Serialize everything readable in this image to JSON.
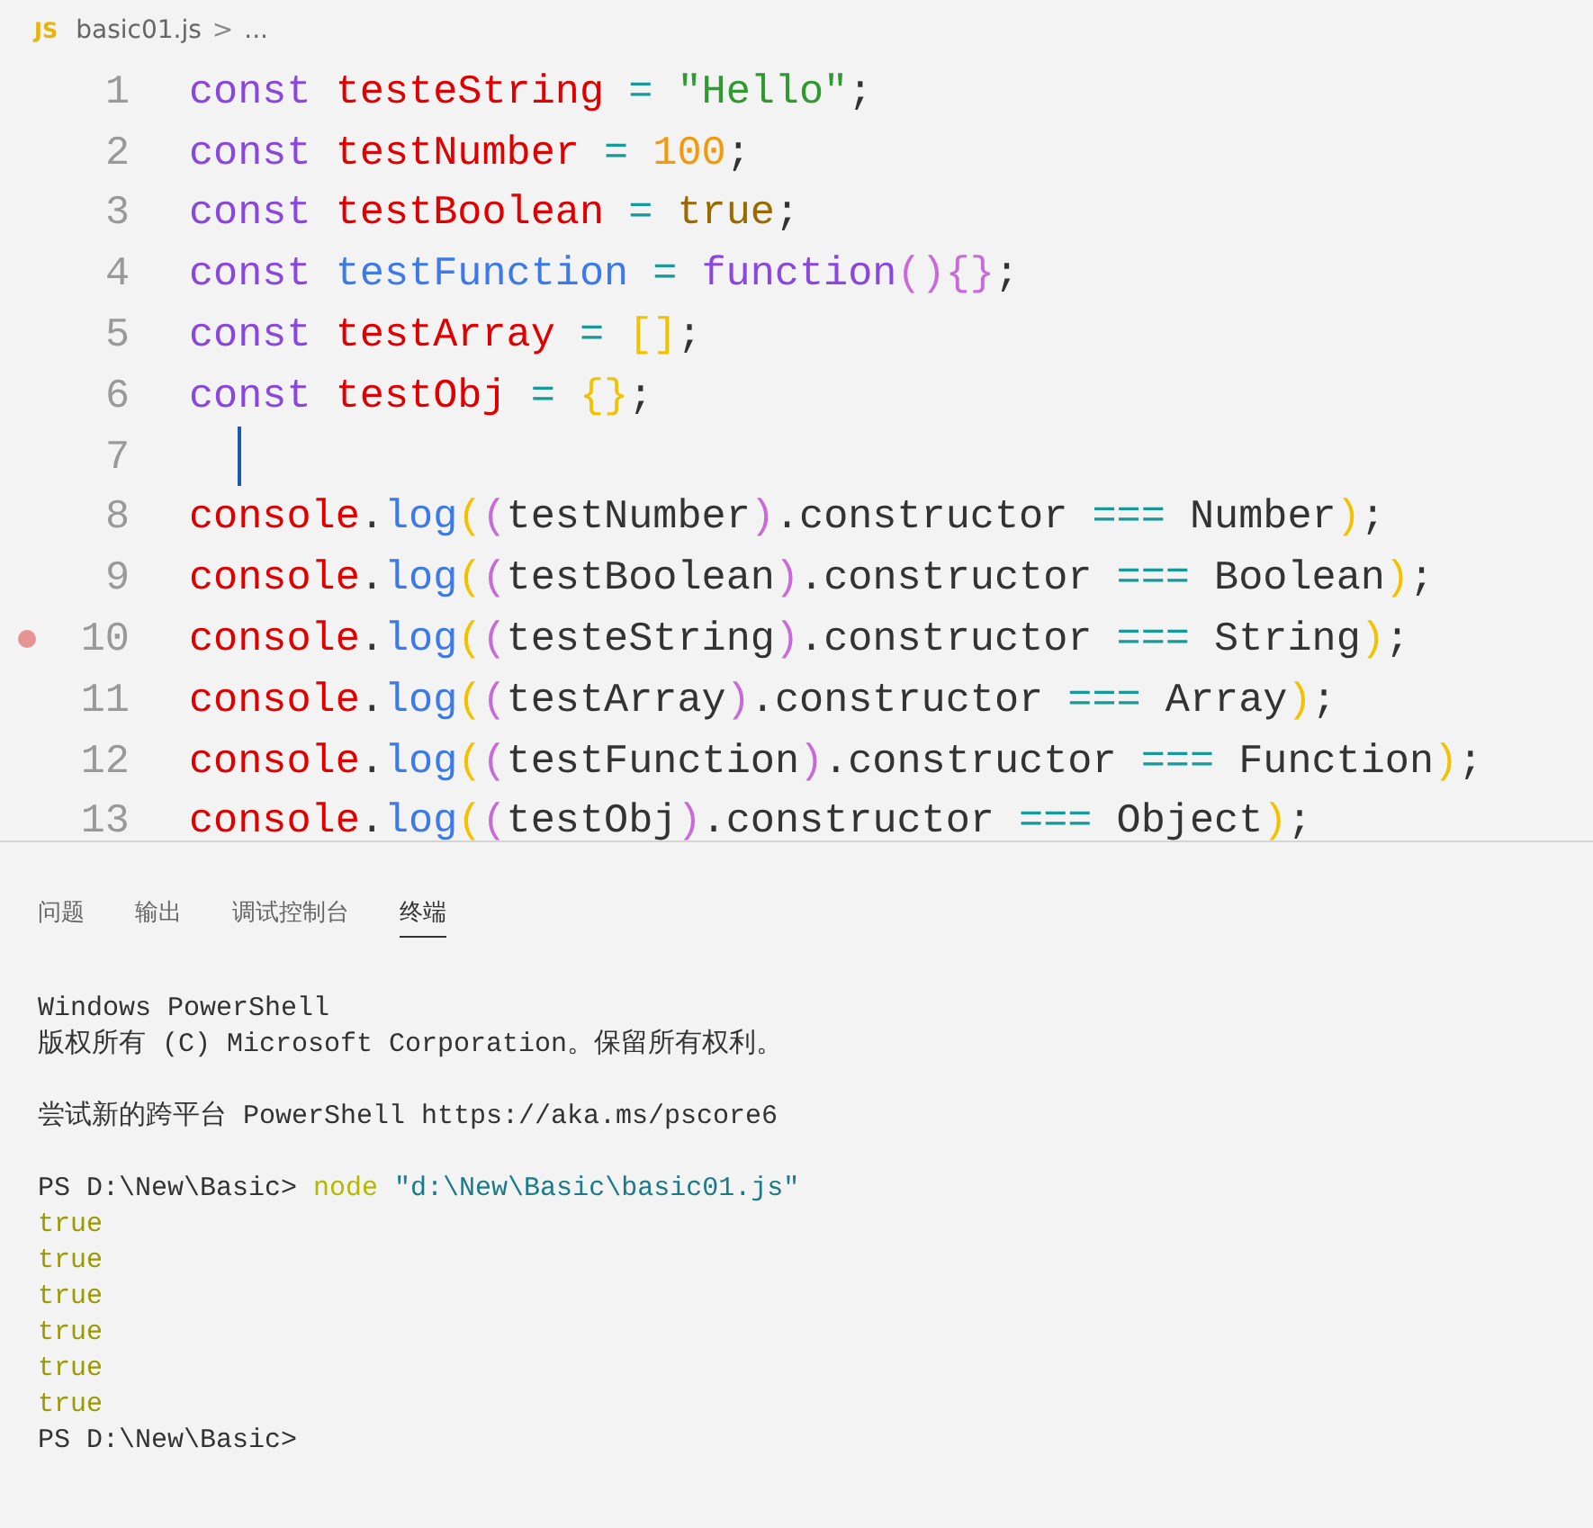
{
  "breadcrumb": {
    "file_badge": "JS",
    "file": "basic01.js",
    "separator": ">",
    "more": "..."
  },
  "editor": {
    "lines": [
      {
        "number": "1",
        "breakpoint": false,
        "cursor": false,
        "tokens": [
          {
            "kind": "keyword",
            "text": "const "
          },
          {
            "kind": "variable",
            "text": "testeString"
          },
          {
            "kind": "operator",
            "text": " = "
          },
          {
            "kind": "string",
            "text": "\"Hello\""
          },
          {
            "kind": "plain",
            "text": ";"
          }
        ]
      },
      {
        "number": "2",
        "breakpoint": false,
        "cursor": false,
        "tokens": [
          {
            "kind": "keyword",
            "text": "const "
          },
          {
            "kind": "variable",
            "text": "testNumber"
          },
          {
            "kind": "operator",
            "text": " = "
          },
          {
            "kind": "number",
            "text": "100"
          },
          {
            "kind": "plain",
            "text": ";"
          }
        ]
      },
      {
        "number": "3",
        "breakpoint": false,
        "cursor": false,
        "tokens": [
          {
            "kind": "keyword",
            "text": "const "
          },
          {
            "kind": "variable",
            "text": "testBoolean"
          },
          {
            "kind": "operator",
            "text": " = "
          },
          {
            "kind": "boolean",
            "text": "true"
          },
          {
            "kind": "plain",
            "text": ";"
          }
        ]
      },
      {
        "number": "4",
        "breakpoint": false,
        "cursor": false,
        "tokens": [
          {
            "kind": "keyword",
            "text": "const "
          },
          {
            "kind": "method",
            "text": "testFunction"
          },
          {
            "kind": "operator",
            "text": " = "
          },
          {
            "kind": "keyword",
            "text": "function"
          },
          {
            "kind": "bracket2",
            "text": "(){}"
          },
          {
            "kind": "plain",
            "text": ";"
          }
        ]
      },
      {
        "number": "5",
        "breakpoint": false,
        "cursor": false,
        "tokens": [
          {
            "kind": "keyword",
            "text": "const "
          },
          {
            "kind": "variable",
            "text": "testArray"
          },
          {
            "kind": "operator",
            "text": " = "
          },
          {
            "kind": "bracket1",
            "text": "[]"
          },
          {
            "kind": "plain",
            "text": ";"
          }
        ]
      },
      {
        "number": "6",
        "breakpoint": false,
        "cursor": false,
        "tokens": [
          {
            "kind": "keyword",
            "text": "const "
          },
          {
            "kind": "variable",
            "text": "testObj"
          },
          {
            "kind": "operator",
            "text": " = "
          },
          {
            "kind": "bracket1",
            "text": "{}"
          },
          {
            "kind": "plain",
            "text": ";"
          }
        ]
      },
      {
        "number": "7",
        "breakpoint": false,
        "cursor": true
      },
      {
        "number": "8",
        "breakpoint": false,
        "cursor": false,
        "tokens": [
          {
            "kind": "variable",
            "text": "console"
          },
          {
            "kind": "plain",
            "text": "."
          },
          {
            "kind": "method",
            "text": "log"
          },
          {
            "kind": "bracket1",
            "text": "("
          },
          {
            "kind": "bracket2",
            "text": "("
          },
          {
            "kind": "plain",
            "text": "testNumber"
          },
          {
            "kind": "bracket2",
            "text": ")"
          },
          {
            "kind": "plain",
            "text": ".constructor "
          },
          {
            "kind": "operator",
            "text": "==="
          },
          {
            "kind": "plain",
            "text": " Number"
          },
          {
            "kind": "bracket1",
            "text": ")"
          },
          {
            "kind": "plain",
            "text": ";"
          }
        ]
      },
      {
        "number": "9",
        "breakpoint": false,
        "cursor": false,
        "tokens": [
          {
            "kind": "variable",
            "text": "console"
          },
          {
            "kind": "plain",
            "text": "."
          },
          {
            "kind": "method",
            "text": "log"
          },
          {
            "kind": "bracket1",
            "text": "("
          },
          {
            "kind": "bracket2",
            "text": "("
          },
          {
            "kind": "plain",
            "text": "testBoolean"
          },
          {
            "kind": "bracket2",
            "text": ")"
          },
          {
            "kind": "plain",
            "text": ".constructor "
          },
          {
            "kind": "operator",
            "text": "==="
          },
          {
            "kind": "plain",
            "text": " Boolean"
          },
          {
            "kind": "bracket1",
            "text": ")"
          },
          {
            "kind": "plain",
            "text": ";"
          }
        ]
      },
      {
        "number": "10",
        "breakpoint": true,
        "cursor": false,
        "tokens": [
          {
            "kind": "variable",
            "text": "console"
          },
          {
            "kind": "plain",
            "text": "."
          },
          {
            "kind": "method",
            "text": "log"
          },
          {
            "kind": "bracket1",
            "text": "("
          },
          {
            "kind": "bracket2",
            "text": "("
          },
          {
            "kind": "plain",
            "text": "testeString"
          },
          {
            "kind": "bracket2",
            "text": ")"
          },
          {
            "kind": "plain",
            "text": ".constructor "
          },
          {
            "kind": "operator",
            "text": "==="
          },
          {
            "kind": "plain",
            "text": " String"
          },
          {
            "kind": "bracket1",
            "text": ")"
          },
          {
            "kind": "plain",
            "text": ";"
          }
        ]
      },
      {
        "number": "11",
        "breakpoint": false,
        "cursor": false,
        "tokens": [
          {
            "kind": "variable",
            "text": "console"
          },
          {
            "kind": "plain",
            "text": "."
          },
          {
            "kind": "method",
            "text": "log"
          },
          {
            "kind": "bracket1",
            "text": "("
          },
          {
            "kind": "bracket2",
            "text": "("
          },
          {
            "kind": "plain",
            "text": "testArray"
          },
          {
            "kind": "bracket2",
            "text": ")"
          },
          {
            "kind": "plain",
            "text": ".constructor "
          },
          {
            "kind": "operator",
            "text": "==="
          },
          {
            "kind": "plain",
            "text": " Array"
          },
          {
            "kind": "bracket1",
            "text": ")"
          },
          {
            "kind": "plain",
            "text": ";"
          }
        ]
      },
      {
        "number": "12",
        "breakpoint": false,
        "cursor": false,
        "tokens": [
          {
            "kind": "variable",
            "text": "console"
          },
          {
            "kind": "plain",
            "text": "."
          },
          {
            "kind": "method",
            "text": "log"
          },
          {
            "kind": "bracket1",
            "text": "("
          },
          {
            "kind": "bracket2",
            "text": "("
          },
          {
            "kind": "plain",
            "text": "testFunction"
          },
          {
            "kind": "bracket2",
            "text": ")"
          },
          {
            "kind": "plain",
            "text": ".constructor "
          },
          {
            "kind": "operator",
            "text": "==="
          },
          {
            "kind": "plain",
            "text": " Function"
          },
          {
            "kind": "bracket1",
            "text": ")"
          },
          {
            "kind": "plain",
            "text": ";"
          }
        ]
      },
      {
        "number": "13",
        "breakpoint": false,
        "cursor": false,
        "tokens": [
          {
            "kind": "variable",
            "text": "console"
          },
          {
            "kind": "plain",
            "text": "."
          },
          {
            "kind": "method",
            "text": "log"
          },
          {
            "kind": "bracket1",
            "text": "("
          },
          {
            "kind": "bracket2",
            "text": "("
          },
          {
            "kind": "plain",
            "text": "testObj"
          },
          {
            "kind": "bracket2",
            "text": ")"
          },
          {
            "kind": "plain",
            "text": ".constructor "
          },
          {
            "kind": "operator",
            "text": "==="
          },
          {
            "kind": "plain",
            "text": " Object"
          },
          {
            "kind": "bracket1",
            "text": ")"
          },
          {
            "kind": "plain",
            "text": ";"
          }
        ]
      }
    ]
  },
  "panel": {
    "tabs": [
      {
        "label": "问题",
        "selected": false
      },
      {
        "label": "输出",
        "selected": false
      },
      {
        "label": "调试控制台",
        "selected": false
      },
      {
        "label": "终端",
        "selected": true
      }
    ],
    "terminal": [
      {
        "kind": "blank"
      },
      {
        "kind": "text",
        "tokens": [
          {
            "kind": "plain",
            "text": "Windows PowerShell"
          }
        ]
      },
      {
        "kind": "text",
        "tokens": [
          {
            "kind": "plain",
            "text": "版权所有 (C) Microsoft Corporation。保留所有权利。"
          }
        ]
      },
      {
        "kind": "blank"
      },
      {
        "kind": "text",
        "tokens": [
          {
            "kind": "plain",
            "text": "尝试新的跨平台 PowerShell https://aka.ms/pscore6"
          }
        ]
      },
      {
        "kind": "blank"
      },
      {
        "kind": "text",
        "tokens": [
          {
            "kind": "plain",
            "text": "PS D:\\New\\Basic> "
          },
          {
            "kind": "command",
            "text": "node "
          },
          {
            "kind": "string",
            "text": "\"d:\\New\\Basic\\basic01.js\""
          }
        ]
      },
      {
        "kind": "text",
        "tokens": [
          {
            "kind": "output",
            "text": "true"
          }
        ]
      },
      {
        "kind": "text",
        "tokens": [
          {
            "kind": "output",
            "text": "true"
          }
        ]
      },
      {
        "kind": "text",
        "tokens": [
          {
            "kind": "output",
            "text": "true"
          }
        ]
      },
      {
        "kind": "text",
        "tokens": [
          {
            "kind": "output",
            "text": "true"
          }
        ]
      },
      {
        "kind": "text",
        "tokens": [
          {
            "kind": "output",
            "text": "true"
          }
        ]
      },
      {
        "kind": "text",
        "tokens": [
          {
            "kind": "output",
            "text": "true"
          }
        ]
      },
      {
        "kind": "text",
        "tokens": [
          {
            "kind": "plain",
            "text": "PS D:\\New\\Basic>"
          }
        ]
      }
    ]
  }
}
